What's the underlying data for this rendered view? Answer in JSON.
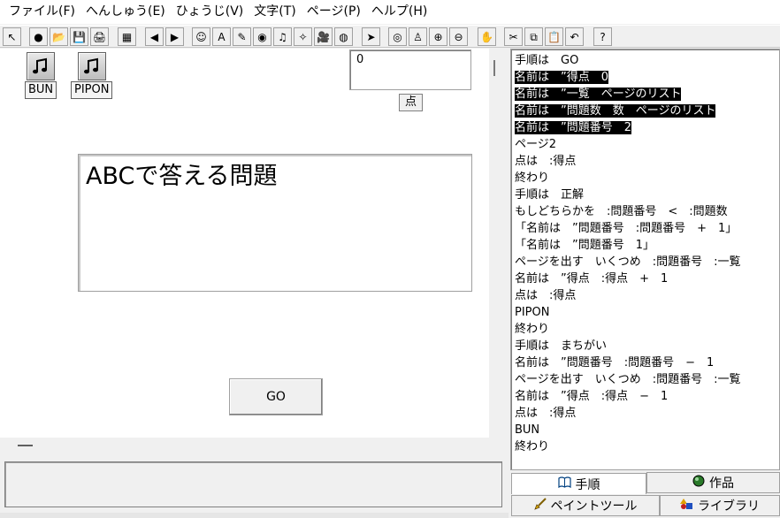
{
  "menu": [
    "ファイル(F)",
    "へんしゅう(E)",
    "ひょうじ(V)",
    "文字(T)",
    "ページ(P)",
    "ヘルプ(H)"
  ],
  "toolbar": {
    "buttons": [
      {
        "name": "pointer-tool-icon",
        "glyph": "↖"
      },
      {
        "name": "new-item-icon",
        "glyph": "●"
      },
      {
        "name": "open-folder-icon",
        "glyph": "📂"
      },
      {
        "name": "save-icon",
        "glyph": "💾"
      },
      {
        "name": "print-icon",
        "glyph": "🖨"
      },
      {
        "name": "page-view-icon",
        "glyph": "▦"
      },
      {
        "name": "prev-page-icon",
        "glyph": "◀"
      },
      {
        "name": "next-page-icon",
        "glyph": "▶"
      },
      {
        "name": "character-icon",
        "glyph": "☺"
      },
      {
        "name": "text-box-icon",
        "glyph": "A"
      },
      {
        "name": "draw-tool-icon",
        "glyph": "✎"
      },
      {
        "name": "button-tool-icon",
        "glyph": "◉"
      },
      {
        "name": "music-icon",
        "glyph": "♫"
      },
      {
        "name": "magic-wand-icon",
        "glyph": "✧"
      },
      {
        "name": "movie-icon",
        "glyph": "🎥"
      },
      {
        "name": "globe-icon",
        "glyph": "◍"
      },
      {
        "name": "select-arrow-icon",
        "glyph": "➤"
      },
      {
        "name": "eye-icon",
        "glyph": "◎"
      },
      {
        "name": "stamp-icon",
        "glyph": "♙"
      },
      {
        "name": "zoom-in-icon",
        "glyph": "⊕"
      },
      {
        "name": "zoom-out-icon",
        "glyph": "⊖"
      },
      {
        "name": "stop-hand-icon",
        "glyph": "✋"
      },
      {
        "name": "cut-icon",
        "glyph": "✂"
      },
      {
        "name": "copy-icon",
        "glyph": "⧉"
      },
      {
        "name": "paste-icon",
        "glyph": "📋"
      },
      {
        "name": "undo-icon",
        "glyph": "↶"
      },
      {
        "name": "help-icon",
        "glyph": "?"
      }
    ]
  },
  "canvas": {
    "sound_buttons": [
      {
        "label": "BUN",
        "icon": "music-note-icon"
      },
      {
        "label": "PIPON",
        "icon": "music-note-icon"
      }
    ],
    "score_value": "0",
    "score_label": "点",
    "question_text": "ABCで答える問題",
    "go_label": "GO"
  },
  "script": {
    "lines": [
      {
        "text": "手順は　GO",
        "highlight": false
      },
      {
        "text": "名前は　”得点　0",
        "highlight": true
      },
      {
        "text": "名前は　”一覧　ページのリスト",
        "highlight": true
      },
      {
        "text": "名前は　”問題数　数　ページのリスト",
        "highlight": true
      },
      {
        "text": "名前は　”問題番号　2",
        "highlight": true
      },
      {
        "text": "ページ2",
        "highlight": false
      },
      {
        "text": "点は　:得点",
        "highlight": false
      },
      {
        "text": "終わり",
        "highlight": false
      },
      {
        "text": "手順は　正解",
        "highlight": false
      },
      {
        "text": "もしどちらかを　:問題番号　<　:問題数",
        "highlight": false
      },
      {
        "text": "「名前は　”問題番号　:問題番号　+　1」",
        "highlight": false
      },
      {
        "text": "「名前は　”問題番号　1」",
        "highlight": false
      },
      {
        "text": "ページを出す　いくつめ　:問題番号　:一覧",
        "highlight": false
      },
      {
        "text": "名前は　”得点　:得点　+　1",
        "highlight": false
      },
      {
        "text": "点は　:得点",
        "highlight": false
      },
      {
        "text": "PIPON",
        "highlight": false
      },
      {
        "text": "終わり",
        "highlight": false
      },
      {
        "text": "手順は　まちがい",
        "highlight": false
      },
      {
        "text": "名前は　”問題番号　:問題番号　−　1",
        "highlight": false
      },
      {
        "text": "ページを出す　いくつめ　:問題番号　:一覧",
        "highlight": false
      },
      {
        "text": "名前は　”得点　:得点　−　1",
        "highlight": false
      },
      {
        "text": "点は　:得点",
        "highlight": false
      },
      {
        "text": "BUN",
        "highlight": false
      },
      {
        "text": "終わり",
        "highlight": false
      }
    ]
  },
  "tabs": {
    "procedure": "手順",
    "works": "作品",
    "paint_tool": "ペイントツール",
    "library": "ライブラリ"
  }
}
